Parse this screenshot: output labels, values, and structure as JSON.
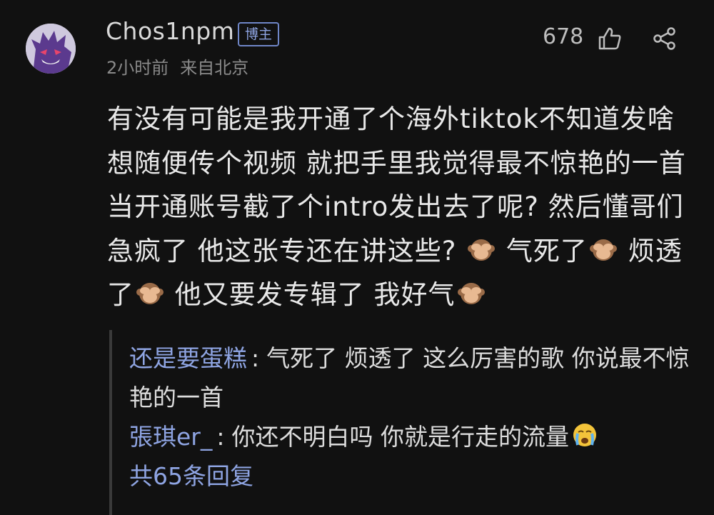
{
  "post": {
    "username": "Chos1npm",
    "badge": "博主",
    "time": "2小时前",
    "location": "来自北京",
    "likes": "678",
    "body_segments": [
      "有没有可能是我开通了个海外tiktok不知道发啥 想随便传个视频 就把手里我觉得最不惊艳的一首当开通账号截了个intro发出去了呢? 然后懂哥们急疯了 他这张专还在讲这些? ",
      " 气死了",
      " 烦透了",
      " 他又要发专辑了 我好气"
    ],
    "emoji": "see-no-evil-monkey"
  },
  "replies": [
    {
      "user": "还是要蛋糕",
      "text": "气死了 烦透了 这么厉害的歌 你说最不惊艳的一首",
      "emoji": ""
    },
    {
      "user": "張琪er_",
      "text": "你还不明白吗 你就是行走的流量",
      "emoji": "crying-face"
    }
  ],
  "reply_colon": ":",
  "reply_count": "共65条回复",
  "colors": {
    "background": "#111111",
    "link": "#8ea4e2",
    "muted": "#8a8a8a"
  }
}
